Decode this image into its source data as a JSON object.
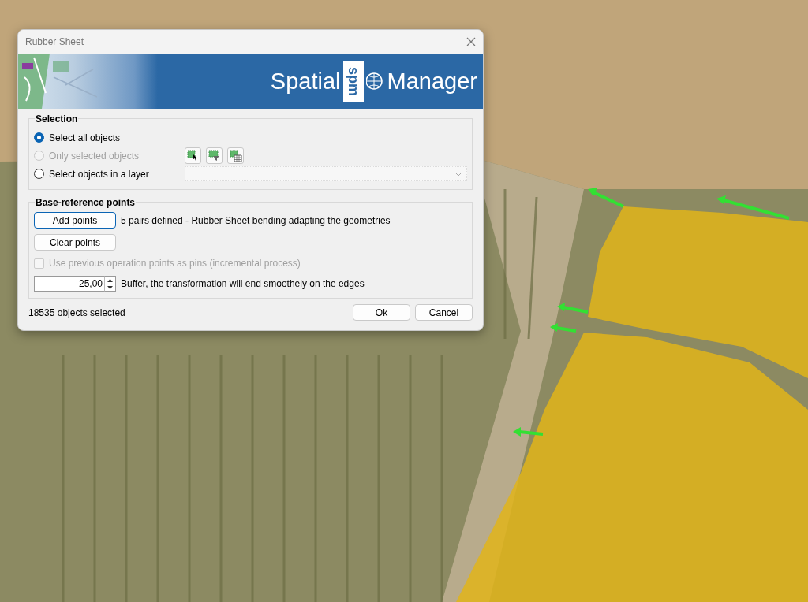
{
  "dialog": {
    "title": "Rubber Sheet",
    "banner": {
      "logo_left": "Spatial",
      "logo_mark": "spm",
      "logo_right": "Manager"
    },
    "selection": {
      "legend": "Selection",
      "options": [
        {
          "label": "Select all objects",
          "selected": true,
          "disabled": false
        },
        {
          "label": "Only selected objects",
          "selected": false,
          "disabled": true
        },
        {
          "label": "Select objects in a layer",
          "selected": false,
          "disabled": false
        }
      ]
    },
    "base_reference": {
      "legend": "Base-reference points",
      "add_button": "Add points",
      "status": "5 pairs defined - Rubber Sheet bending adapting the geometries",
      "clear_button": "Clear points",
      "pins_checkbox": {
        "label": "Use previous operation points as pins (incremental process)",
        "checked": false,
        "disabled": true
      },
      "buffer": {
        "value": "25,00",
        "description": "Buffer, the transformation will end smoothely on the edges"
      }
    },
    "status": "18535 objects selected",
    "buttons": [
      "Ok",
      "Cancel"
    ]
  }
}
